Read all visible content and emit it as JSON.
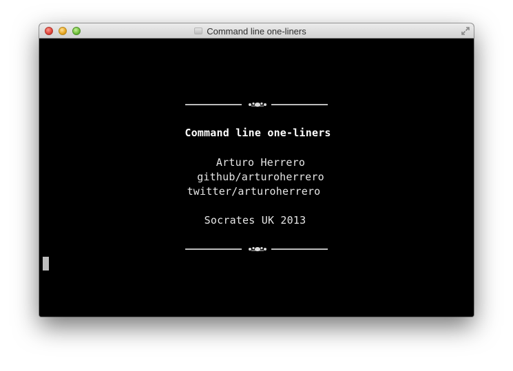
{
  "window": {
    "title": "Command line one-liners"
  },
  "slide": {
    "title": "Command line one-liners",
    "author": "Arturo Herrero",
    "github": "github/arturoherrero",
    "twitter": "twitter/arturoherrero",
    "event": "Socrates UK 2013"
  },
  "icons": {
    "traffic_lights": [
      "close-icon",
      "minimize-icon",
      "zoom-icon"
    ],
    "fullscreen": "fullscreen-icon",
    "ornament": "fleuron-divider"
  },
  "colors": {
    "terminal_background": "#000000",
    "terminal_text": "#e6e6e6",
    "cursor": "#bdbdbd",
    "close": "#e0443a",
    "minimize": "#e7a51f",
    "zoom": "#6fbf3a"
  }
}
